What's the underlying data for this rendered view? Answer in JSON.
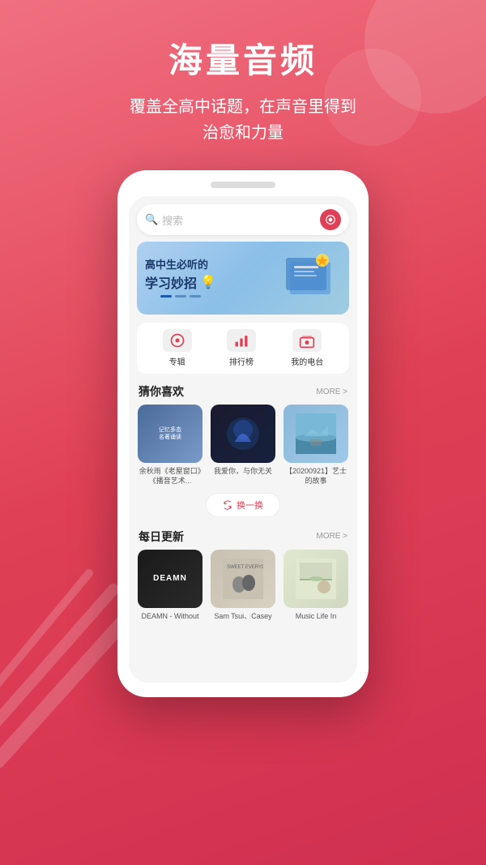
{
  "header": {
    "main_title": "海量音频",
    "sub_title_line1": "覆盖全高中话题，在声音里得到",
    "sub_title_line2": "治愈和力量"
  },
  "phone": {
    "search": {
      "placeholder": "搜索",
      "icon": "🔍"
    },
    "banner": {
      "title": "高中生必听的",
      "subtitle": "学习妙招",
      "emoji": "💡"
    },
    "quick_menu": [
      {
        "label": "专辑",
        "icon": "🎵"
      },
      {
        "label": "排行榜",
        "icon": "📊"
      },
      {
        "label": "我的电台",
        "icon": "📻"
      }
    ],
    "recommend_section": {
      "title": "猜你喜欢",
      "more": "MORE >"
    },
    "recommend_cards": [
      {
        "label": "余秋雨《老屋窗口》《播音艺术...",
        "thumb_type": "book"
      },
      {
        "label": "我爱你，与你无关",
        "thumb_type": "wave"
      },
      {
        "label": "【20200921】艺士的故事",
        "thumb_type": "sky"
      }
    ],
    "refresh_button": "换一换",
    "daily_section": {
      "title": "每日更新",
      "more": "MORE >"
    },
    "daily_cards": [
      {
        "label": "DEAMN - Without",
        "thumb_type": "deamn",
        "text": "DEAMN"
      },
      {
        "label": "Sam Tsui、Casey",
        "thumb_type": "sam"
      },
      {
        "label": "Music Life In",
        "thumb_type": "music"
      }
    ]
  },
  "colors": {
    "primary": "#e04055",
    "accent": "#d03050",
    "background_start": "#f07080",
    "background_end": "#d03050"
  }
}
